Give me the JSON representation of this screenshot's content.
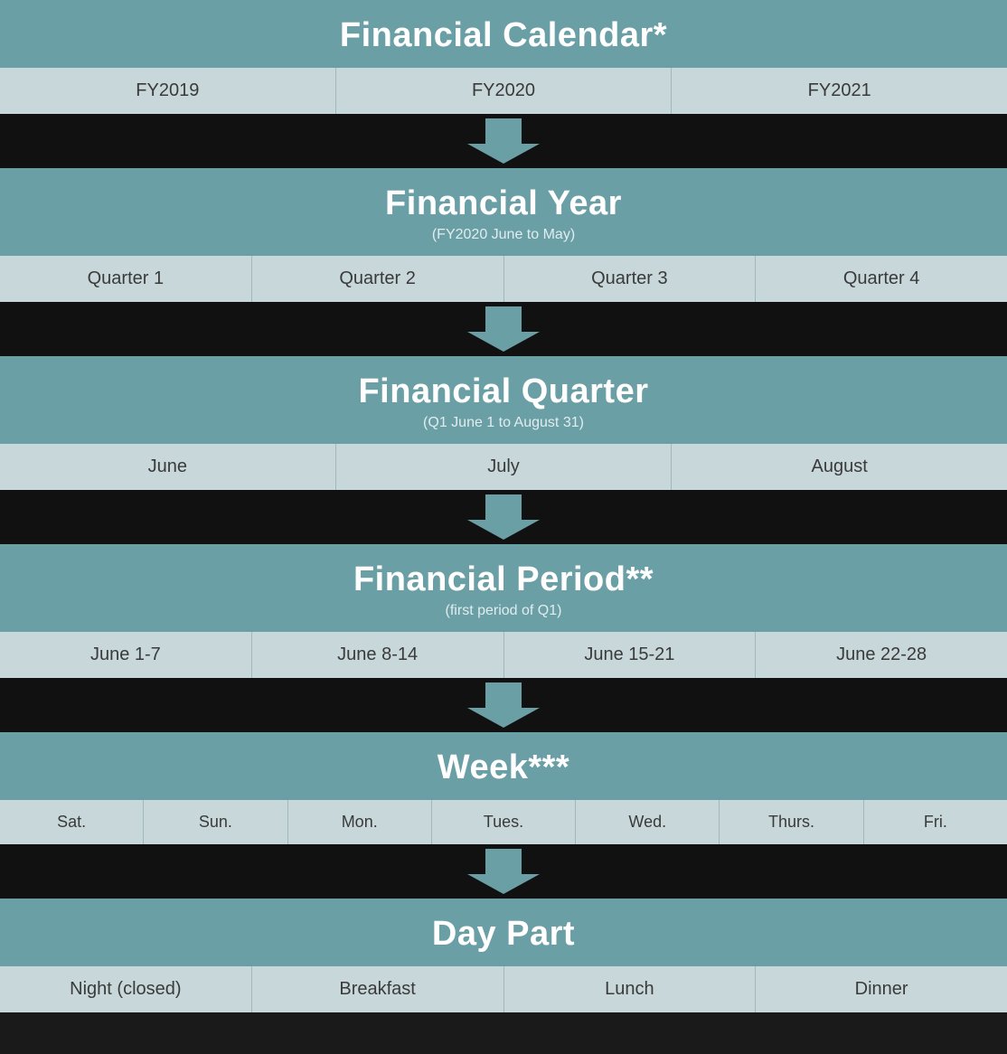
{
  "diagram": {
    "title": "Financial Calendar*",
    "sections": [
      {
        "id": "financial-year-header",
        "title": "Financial Year",
        "subtitle": "(FY2020 June to May)",
        "items": [
          "FY2019",
          "FY2020",
          "FY2021"
        ]
      },
      {
        "id": "financial-quarter-header",
        "title": "Financial Quarter",
        "subtitle": "(Q1 June 1 to August 31)",
        "items": [
          "Quarter 1",
          "Quarter 2",
          "Quarter 3",
          "Quarter 4"
        ]
      },
      {
        "id": "financial-month-header",
        "title": null,
        "subtitle": null,
        "items": [
          "June",
          "July",
          "August"
        ]
      },
      {
        "id": "financial-period-header",
        "title": "Financial Period**",
        "subtitle": "(first period of Q1)",
        "items": [
          "June 1-7",
          "June 8-14",
          "June 15-21",
          "June 22-28"
        ]
      },
      {
        "id": "week-header",
        "title": "Week***",
        "subtitle": null,
        "items": [
          "Sat.",
          "Sun.",
          "Mon.",
          "Tues.",
          "Wed.",
          "Thurs.",
          "Fri."
        ]
      },
      {
        "id": "day-part-header",
        "title": "Day Part",
        "subtitle": null,
        "items": [
          "Night (closed)",
          "Breakfast",
          "Lunch",
          "Dinner"
        ]
      }
    ]
  }
}
